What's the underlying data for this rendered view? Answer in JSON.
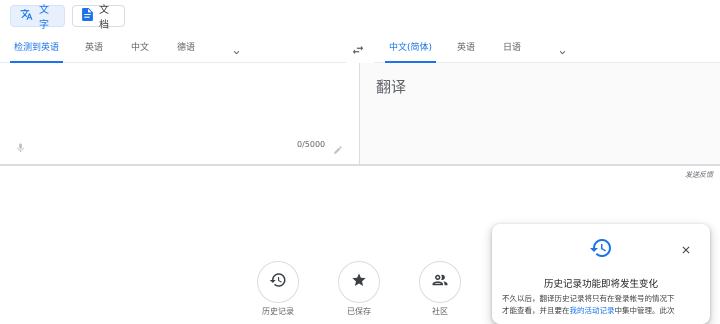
{
  "mode_tabs": [
    {
      "label": "文字",
      "icon": "translate-icon",
      "active": true
    },
    {
      "label": "文档",
      "icon": "document-icon",
      "active": false
    }
  ],
  "source_languages": {
    "tabs": [
      "检测到英语",
      "英语",
      "中文",
      "德语"
    ],
    "selected": "检测到英语"
  },
  "target_languages": {
    "tabs": [
      "中文(简体)",
      "英语",
      "日语"
    ],
    "selected": "中文(简体)"
  },
  "source_panel": {
    "char_count": "0/5000"
  },
  "target_panel": {
    "placeholder": "翻译"
  },
  "feedback_link": "发送反馈",
  "bottom_actions": [
    {
      "label": "历史记录",
      "icon": "history-icon"
    },
    {
      "label": "已保存",
      "icon": "star-icon"
    },
    {
      "label": "社区",
      "icon": "community-icon"
    }
  ],
  "popup": {
    "icon": "history-icon",
    "title": "历史记录功能即将发生变化",
    "line1": "不久以后，翻译历史记录将只有在登录帐号的情况下",
    "line2_prefix": "才能查看，并且要在",
    "line2_link": "我的活动记录",
    "line2_suffix": "中集中管理。此次"
  },
  "colors": {
    "accent": "#1a73e8",
    "accent_bg": "#e8f0fe",
    "text": "#3c4043",
    "muted": "#5f6368",
    "border": "#dadce0"
  }
}
